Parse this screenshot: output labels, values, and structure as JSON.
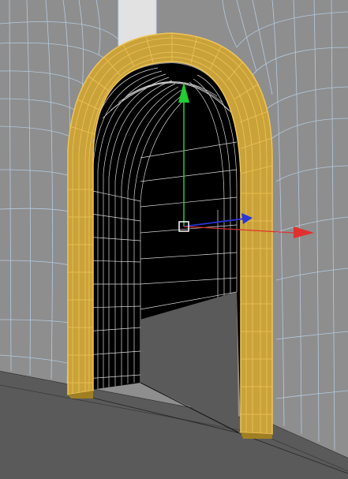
{
  "viewport": {
    "label": "",
    "colors": {
      "background": "#575757",
      "floor": "#5a5a5a",
      "wall": "#8e8e8e",
      "wall_wire": "#b9d2ea",
      "opening": "#000000",
      "inner_wire": "#ffffff",
      "frame": "#c9a23a",
      "frame_dark": "#9f7f22",
      "frame_wire": "#f0c556",
      "pillar": "#e2e2e2"
    }
  },
  "gizmo": {
    "type": "move-transform-gizmo",
    "axes": [
      {
        "name": "y",
        "color": "#22cc33"
      },
      {
        "name": "z",
        "color": "#2a35d8"
      },
      {
        "name": "x",
        "color": "#e03030"
      }
    ],
    "pivot_color": "#ffffff"
  }
}
